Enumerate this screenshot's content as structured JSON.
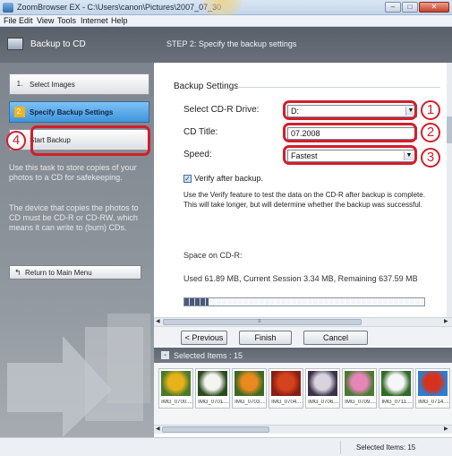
{
  "window": {
    "title": "ZoomBrowser EX - C:\\Users\\canon\\Pictures\\2007_07_30",
    "min": "–",
    "max": "□",
    "close": "✕"
  },
  "menu": [
    "File",
    "Edit",
    "View",
    "Tools",
    "Internet",
    "Help"
  ],
  "left_panel": {
    "title": "Backup to CD",
    "steps": [
      {
        "num": "1.",
        "label": "Select Images"
      },
      {
        "num": "2.",
        "label": "Specify Backup Settings"
      },
      {
        "num": "3.",
        "label": "Start Backup"
      }
    ],
    "description1": "Use this task to store copies of your photos to a CD for safekeeping.",
    "description2": "The device that copies the photos to CD must be CD-R or CD-RW, which means it can write to (burn) CDs.",
    "return_label": "Return to Main Menu",
    "return_icon": "↰"
  },
  "step_header": "STEP 2: Specify the backup settings",
  "backup_settings": {
    "group_title": "Backup Settings",
    "drive_label": "Select CD-R Drive:",
    "drive_value": "D:",
    "title_label": "CD Title:",
    "title_value": "07.2008",
    "speed_label": "Speed:",
    "speed_value": "Fastest",
    "verify_label": "Verify after backup.",
    "verify_checked": true,
    "verify_desc": "Use the Verify feature to test the data on the CD-R after backup is complete. This will take longer, but will determine whether the backup was successful.",
    "space_label": "Space on CD-R:",
    "space_info": "Used 61.89 MB, Current Session 3.34 MB, Remaining 637.59 MB",
    "space_used_fraction": 0.1
  },
  "annotations": [
    "1",
    "2",
    "3",
    "4"
  ],
  "buttons": {
    "previous": "< Previous",
    "finish": "Finish",
    "cancel": "Cancel"
  },
  "selected_items_header": "Selected Items : 15",
  "thumbnails": [
    {
      "label": "IMG_0700....",
      "color1": "#e8b21a",
      "color2": "#4a7a2a"
    },
    {
      "label": "IMG_0701....",
      "color1": "#f4f4f0",
      "color2": "#2a4a1c"
    },
    {
      "label": "IMG_0703....",
      "color1": "#e98a1e",
      "color2": "#3d6a23"
    },
    {
      "label": "IMG_0704....",
      "color1": "#d4431e",
      "color2": "#8a1e14"
    },
    {
      "label": "IMG_0706....",
      "color1": "#d9d3e0",
      "color2": "#3a3248"
    },
    {
      "label": "IMG_0709....",
      "color1": "#e585b8",
      "color2": "#4b7a32"
    },
    {
      "label": "IMG_0711....",
      "color1": "#f6f6f6",
      "color2": "#2f6a26"
    },
    {
      "label": "IMG_0714....",
      "color1": "#d8321e",
      "color2": "#2a7fd0"
    }
  ],
  "status": "Selected Items: 15",
  "colors": {
    "annotation": "#d21f2b",
    "active_step": "#3f94dc"
  }
}
